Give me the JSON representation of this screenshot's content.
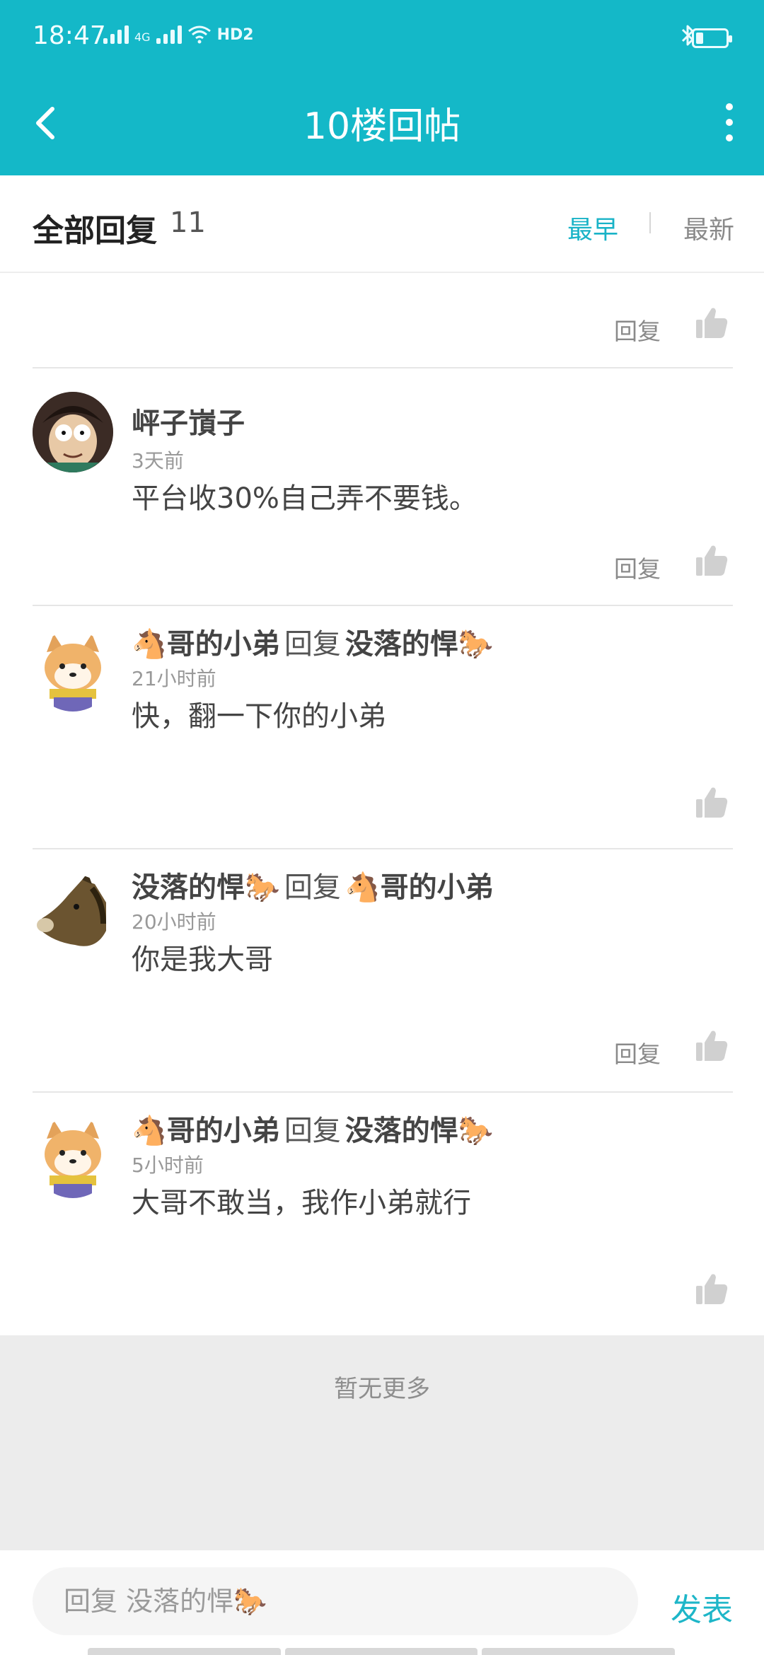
{
  "status_bar": {
    "time": "18:47",
    "signal_label": "4G",
    "hd_label": "HD2",
    "battery_level": 0.25,
    "icons": [
      "signal-icon",
      "wifi-icon",
      "bluetooth-icon",
      "battery-icon"
    ]
  },
  "header": {
    "title": "10楼回帖",
    "back_icon": "chevron-left-icon",
    "menu_icon": "more-vertical-icon",
    "bg_color": "#14b8c8"
  },
  "filter": {
    "label": "全部回复",
    "count": "11",
    "sort_options": [
      "最早",
      "最新"
    ],
    "active_sort": "最早",
    "accent_color": "#19b3c7"
  },
  "top_actions": {
    "reply_label": "回复"
  },
  "comments": [
    {
      "author": "岼子嵿子",
      "reply_label": "",
      "target": "",
      "time": "3天前",
      "text": "平台收30%自己弄不要钱。",
      "reply_button": "回复"
    },
    {
      "author": "🐴哥的小弟",
      "reply_label": "回复",
      "target": "没落的悍🐎",
      "time": "21小时前",
      "text": "快，翻一下你的小弟",
      "reply_button": ""
    },
    {
      "author": "没落的悍🐎",
      "reply_label": "回复",
      "target": "🐴哥的小弟",
      "time": "20小时前",
      "text": "你是我大哥",
      "reply_button": "回复"
    },
    {
      "author": "🐴哥的小弟",
      "reply_label": "回复",
      "target": "没落的悍🐎",
      "time": "5小时前",
      "text": "大哥不敢当，我作小弟就行",
      "reply_button": ""
    }
  ],
  "no_more": "暂无更多",
  "bottom_bar": {
    "input_placeholder": "回复 没落的悍🐎",
    "publish_label": "发表"
  }
}
